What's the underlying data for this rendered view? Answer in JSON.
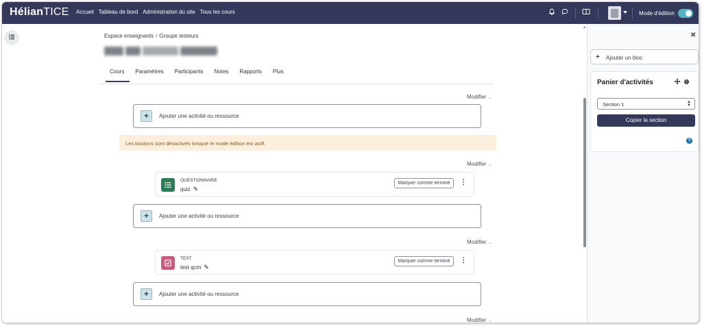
{
  "brand": {
    "part1": "Hélian",
    "part2": "TICE"
  },
  "nav": {
    "links": [
      "Accueil",
      "Tableau de bord",
      "Administration du site",
      "Tous les cours"
    ],
    "edit_mode_label": "Mode d'édition",
    "edit_mode_on": true,
    "icons": [
      "bell-icon",
      "chat-icon",
      "book-icon",
      "user-avatar"
    ]
  },
  "breadcrumb": {
    "items": [
      "Espace enseignants",
      "Groupe testeurs"
    ],
    "separator": "/"
  },
  "page_title": {
    "blurred": true
  },
  "tabs": {
    "items": [
      "Cours",
      "Paramètres",
      "Participants",
      "Notes",
      "Rapports",
      "Plus"
    ],
    "active": "Cours"
  },
  "course": {
    "modifier_label": "Modifier",
    "add_activity_label": "Ajouter une activité ou ressource",
    "alert_text": "Les boutons sont désactivés lorsque le mode édition est actif.",
    "mark_done_label": "Marquer comme terminé",
    "activities": [
      {
        "type": "QUESTIONNAIRE",
        "name": "quiz",
        "icon": "quiz-list-icon",
        "color": "#2f7d58"
      },
      {
        "type": "TEST",
        "name": "test qcm",
        "icon": "checkbox-icon",
        "color": "#c75b80"
      }
    ]
  },
  "drawer": {
    "add_block_label": "Ajouter un bloc",
    "block_title": "Panier d'activités",
    "section_value": "Section 1",
    "copy_button_label": "Copier la section"
  },
  "colors": {
    "navbar": "#34385a",
    "accent": "#56b5c4",
    "quiz": "#2f7d58",
    "test": "#c75b80",
    "alert_bg": "#fbeedd"
  }
}
